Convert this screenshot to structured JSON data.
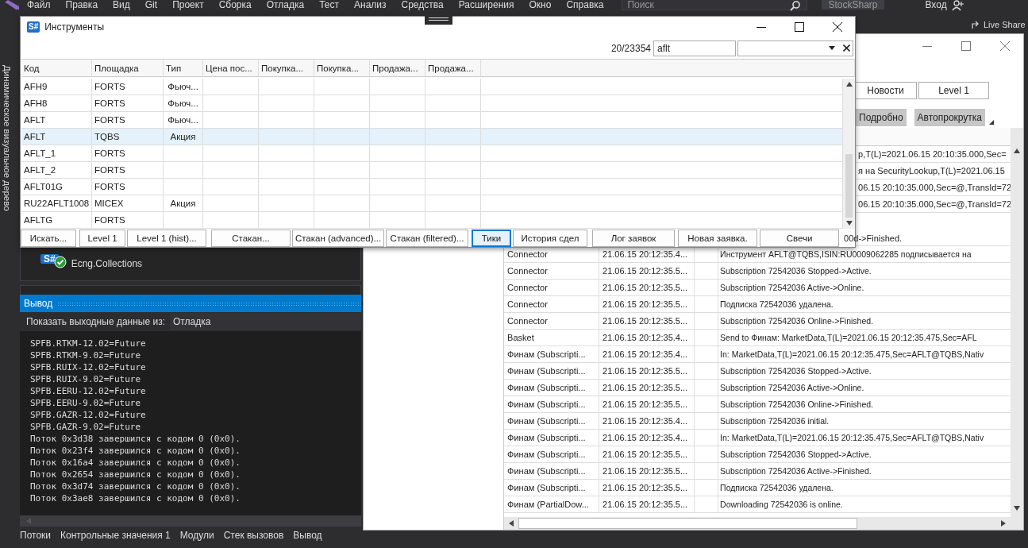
{
  "ide": {
    "menu": [
      "Файл",
      "Правка",
      "Вид",
      "Git",
      "Проект",
      "Сборка",
      "Отладка",
      "Тест",
      "Анализ",
      "Средства",
      "Расширения",
      "Окно",
      "Справка"
    ],
    "search_placeholder": "Поиск",
    "solution_name": "StockSharp",
    "sign_in": "Вход",
    "live_share": "Live Share",
    "side_tab": "Динамическое визуальное дерево",
    "solution_item": {
      "logo": "S#",
      "label": "Ecng.Collections"
    },
    "output": {
      "title": "Вывод",
      "source_label": "Показать выходные данные из:",
      "source": "Отладка",
      "lines": [
        "SPFB.RTKM-12.02=Future",
        "SPFB.RTKM-9.02=Future",
        "SPFB.RUIX-12.02=Future",
        "SPFB.RUIX-9.02=Future",
        "SPFB.EERU-12.02=Future",
        "SPFB.EERU-9.02=Future",
        "SPFB.GAZR-12.02=Future",
        "SPFB.GAZR-9.02=Future",
        "Поток 0x3d38 завершился с кодом 0 (0x0).",
        "Поток 0x23f4 завершился с кодом 0 (0x0).",
        "Поток 0x16a4 завершился с кодом 0 (0x0).",
        "Поток 0x2654 завершился с кодом 0 (0x0).",
        "Поток 0x3d74 завершился с кодом 0 (0x0).",
        "Поток 0x3ae8 завершился с кодом 0 (0x0)."
      ]
    },
    "bottom_tabs": [
      "Потоки",
      "Контрольные значения 1",
      "Модули",
      "Стек вызовов",
      "Вывод"
    ]
  },
  "instruments": {
    "logo": "S#",
    "title": "Инструменты",
    "count": "20/23354",
    "search": "aflt",
    "columns": [
      "Код",
      "Площадка",
      "Тип",
      "Цена пос...",
      "Покупка...",
      "Покупка...",
      "Продажа...",
      "Продажа..."
    ],
    "rows": [
      {
        "cells": [
          "AFH9",
          "FORTS",
          "Фьюч..."
        ],
        "selected": false
      },
      {
        "cells": [
          "AFH8",
          "FORTS",
          "Фьюч..."
        ],
        "selected": false
      },
      {
        "cells": [
          "AFLT",
          "FORTS",
          "Фьюч..."
        ],
        "selected": false
      },
      {
        "cells": [
          "AFLT",
          "TQBS",
          "Акция"
        ],
        "selected": true
      },
      {
        "cells": [
          "AFLT_1",
          "FORTS"
        ],
        "selected": false
      },
      {
        "cells": [
          "AFLT_2",
          "FORTS"
        ],
        "selected": false
      },
      {
        "cells": [
          "AFLT01G",
          "FORTS"
        ],
        "selected": false
      },
      {
        "cells": [
          "RU22AFLT1008",
          "MICEX",
          "Акция"
        ],
        "selected": false
      },
      {
        "cells": [
          "AFLTG",
          "FORTS"
        ],
        "selected": false
      }
    ],
    "buttons": [
      {
        "label": "Искать...",
        "selected": false
      },
      {
        "label": "Level 1",
        "selected": false
      },
      {
        "label": "Level 1 (hist)...",
        "selected": false
      },
      {
        "label": "Стакан...",
        "selected": false
      },
      {
        "label": "Стакан (advanced)...",
        "selected": false
      },
      {
        "label": "Стакан (filtered)...",
        "selected": false
      },
      {
        "label": "Тики",
        "selected": true
      },
      {
        "label": "История сдел",
        "selected": false
      },
      {
        "label": "Лог заявок",
        "selected": false
      },
      {
        "label": "Новая заявка.",
        "selected": false
      },
      {
        "label": "Свечи",
        "selected": false
      }
    ]
  },
  "log_window": {
    "buttons": [
      "Новости",
      "Level 1"
    ],
    "toolbar": [
      "Подробно",
      "Автопрокрутка"
    ],
    "covered_rows": [
      {
        "kind": "message",
        "message": "p,T(L)=2021.06.15 20:10:35.000,Sec="
      },
      {
        "kind": "message",
        "message": "я на SecurityLookup,T(L)=2021.06.15"
      },
      {
        "kind": "message",
        "message": "06.15 20:10:35.000,Sec=@,TransId=72"
      },
      {
        "kind": "message",
        "message": "06.15 20:10:35.000,Sec=@,TransId=72"
      },
      {
        "kind": "tail",
        "message": "00d->Finished."
      }
    ],
    "rows": [
      {
        "source": "Connector",
        "time": "21.06.15 20:12:35.4...",
        "message": "Инструмент AFLT@TQBS,ISIN:RU0009062285 подписывается на"
      },
      {
        "source": "Connector",
        "time": "21.06.15 20:12:35.5...",
        "message": "Subscription 72542036 Stopped->Active."
      },
      {
        "source": "Connector",
        "time": "21.06.15 20:12:35.5...",
        "message": "Subscription 72542036 Active->Online."
      },
      {
        "source": "Connector",
        "time": "21.06.15 20:12:35.5...",
        "message": "Подписка 72542036 удалена."
      },
      {
        "source": "Connector",
        "time": "21.06.15 20:12:35.5...",
        "message": "Subscription 72542036 Online->Finished."
      },
      {
        "source": "Basket",
        "time": "21.06.15 20:12:35.4...",
        "message": "Send to Финам: MarketData,T(L)=2021.06.15 20:12:35.475,Sec=AFL"
      },
      {
        "source": "Финам (Subscripti...",
        "time": "21.06.15 20:12:35.4...",
        "message": "In: MarketData,T(L)=2021.06.15 20:12:35.475,Sec=AFLT@TQBS,Nativ"
      },
      {
        "source": "Финам (Subscripti...",
        "time": "21.06.15 20:12:35.5...",
        "message": "Subscription 72542036 Stopped->Active."
      },
      {
        "source": "Финам (Subscripti...",
        "time": "21.06.15 20:12:35.5...",
        "message": "Subscription 72542036 Active->Online."
      },
      {
        "source": "Финам (Subscripti...",
        "time": "21.06.15 20:12:35.5...",
        "message": "Subscription 72542036 Online->Finished."
      },
      {
        "source": "Финам (Subscripti...",
        "time": "21.06.15 20:12:35.4...",
        "message": "Subscription 72542036 initial."
      },
      {
        "source": "Финам (Subscripti...",
        "time": "21.06.15 20:12:35.4...",
        "message": "In: MarketData,T(L)=2021.06.15 20:12:35.475,Sec=AFLT@TQBS,Nativ"
      },
      {
        "source": "Финам (Subscripti...",
        "time": "21.06.15 20:12:35.5...",
        "message": "Subscription 72542036 Stopped->Active."
      },
      {
        "source": "Финам (Subscripti...",
        "time": "21.06.15 20:12:35.5...",
        "message": "Subscription 72542036 Active->Finished."
      },
      {
        "source": "Финам (Subscripti...",
        "time": "21.06.15 20:12:35.5...",
        "message": "Подписка 72542036 удалена."
      },
      {
        "source": "Финам (PartialDow...",
        "time": "21.06.15 20:12:35.5...",
        "message": "Downloading 72542036 is online."
      }
    ]
  }
}
